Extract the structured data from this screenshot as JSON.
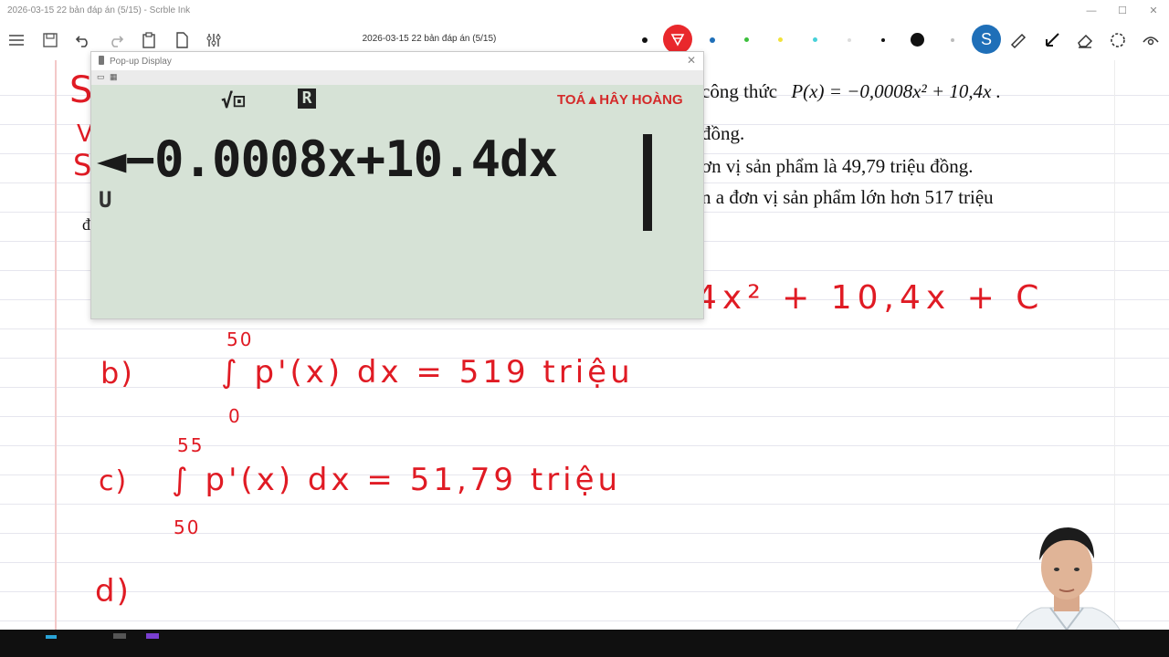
{
  "window": {
    "title": "2026-03-15 22 bản đáp án  (5/15)  - Scrble Ink",
    "controls": [
      "—",
      "☐",
      "✕"
    ]
  },
  "toolbar": {
    "doc_title": "2026-03-15 22 bản đáp án (5/15)",
    "icons": [
      "menu-icon",
      "save-icon",
      "undo-icon",
      "redo-icon",
      "paste-icon",
      "page-icon",
      "sliders-icon"
    ],
    "pen_colors": [
      "#111111",
      "#e9282c",
      "#1f6fb8",
      "#3cbf3c",
      "#f2e23a",
      "#47d1d9",
      "#dddddd",
      "#111111",
      "#111111",
      "#bbbbbb",
      "#1f6fb8"
    ],
    "tools": [
      "ruler-icon",
      "pointer-icon",
      "eraser-icon",
      "lasso-icon",
      "view-icon"
    ]
  },
  "problem": {
    "line1": "công thức",
    "formula": "P(x) = −0,0008x² + 10,4x .",
    "line2": "đồng.",
    "line3": "ơn vị sản phẩm là  49,79  triệu đồng.",
    "line4": "n  a  đơn vị sản phẩm lớn hơn  517  triệu",
    "line4b": "đ"
  },
  "handwriting": {
    "a_integral": "4x² + 10,4x + C",
    "b_label": "b)",
    "b_upper": "50",
    "b_lower": "0",
    "b_integrand": "∫ p'(x) dx  =  519  triệu",
    "c_label": "c)",
    "c_upper": "55",
    "c_lower": "50",
    "c_integrand": "∫ p'(x) dx  =  51,79  triệu",
    "d_label": "d)",
    "margin_letters": [
      "S",
      "V",
      "S",
      "ĉ"
    ]
  },
  "calculator": {
    "title": "Pop-up Display",
    "brand": "TOÁ▲HÂY HOÀNG",
    "indicator_sqrt": "√⊡",
    "indicator_r": "R",
    "expression": "◄−0.0008x+10.4dx",
    "indicator_u": "U"
  }
}
